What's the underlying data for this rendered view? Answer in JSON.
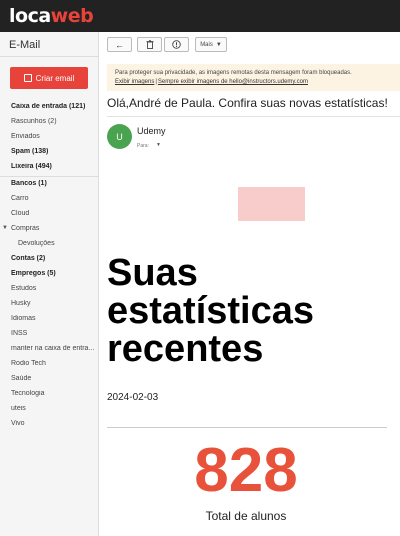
{
  "brand": {
    "logo_prefix": "loca",
    "logo_suffix": "web",
    "accent": "#e8433a"
  },
  "sidebar": {
    "title": "E-Mail",
    "compose_label": "Criar email",
    "folders": [
      {
        "label": "Caixa de entrada (121)",
        "bold": true
      },
      {
        "label": "Rascunhos (2)"
      },
      {
        "label": "Enviados"
      },
      {
        "label": "Spam (138)",
        "bold": true
      },
      {
        "label": "Lixeira (494)",
        "bold": true
      },
      {
        "label": "Bancos (1)",
        "bold": true
      },
      {
        "label": "Carro"
      },
      {
        "label": "Cloud"
      },
      {
        "label": "Compras"
      },
      {
        "label": "Devoluções"
      },
      {
        "label": "Contas (2)",
        "bold": true
      },
      {
        "label": "Empregos (5)",
        "bold": true
      },
      {
        "label": "Estudos"
      },
      {
        "label": "Husky"
      },
      {
        "label": "Idiomas"
      },
      {
        "label": "INSS"
      },
      {
        "label": "manter na caixa de entra..."
      },
      {
        "label": "Rodio Tech"
      },
      {
        "label": "Saúde"
      },
      {
        "label": "Tecnologia"
      },
      {
        "label": "uteis"
      },
      {
        "label": "Vivo"
      }
    ]
  },
  "toolbar": {
    "back_icon": "←",
    "delete_icon": "🗑",
    "spam_icon": "!",
    "more_label": "Mais"
  },
  "notice": {
    "text": "Para proteger sua privacidade, as imagens remotas desta mensagem foram bloqueadas.",
    "show_images": "Exibir imagens",
    "always_show": "Sempre exibir imagens de hello@instructors.udemy.com"
  },
  "message": {
    "subject": "Olá,André de Paula. Confira suas novas estatísticas!",
    "avatar_letter": "U",
    "sender": "Udemy",
    "to_label": "Para:",
    "heading_line1": "Suas",
    "heading_line2": "estatísticas",
    "heading_line3": "recentes",
    "date": "2024-02-03",
    "stat_number": "828",
    "stat_label": "Total de alunos"
  }
}
